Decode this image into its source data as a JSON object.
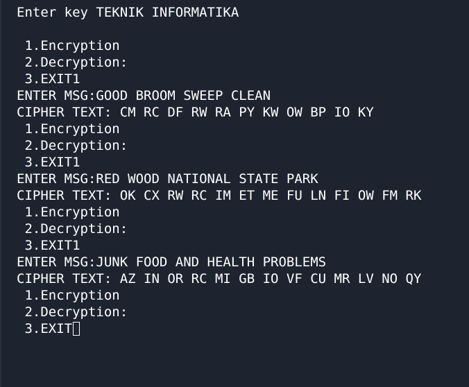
{
  "terminal": {
    "header": "Enter key TEKNIK INFORMATIKA",
    "lines": [
      " 1.Encryption",
      " 2.Decryption:",
      " 3.EXIT1",
      "ENTER MSG:GOOD BROOM SWEEP CLEAN",
      "CIPHER TEXT: CM RC DF RW RA PY KW OW BP IO KY",
      " 1.Encryption",
      " 2.Decryption:",
      " 3.EXIT1",
      "ENTER MSG:RED WOOD NATIONAL STATE PARK",
      "CIPHER TEXT: OK CX RW RC IM ET ME FU LN FI OW FM RK",
      " 1.Encryption",
      " 2.Decryption:",
      " 3.EXIT1",
      "ENTER MSG:JUNK FOOD AND HEALTH PROBLEMS",
      "CIPHER TEXT: AZ IN OR RC MI GB IO VF CU MR LV NO QY",
      " 1.Encryption",
      " 2.Decryption:"
    ],
    "prompt": " 3.EXIT"
  },
  "colors": {
    "background": "#1e2330",
    "text": "#ffffff"
  }
}
